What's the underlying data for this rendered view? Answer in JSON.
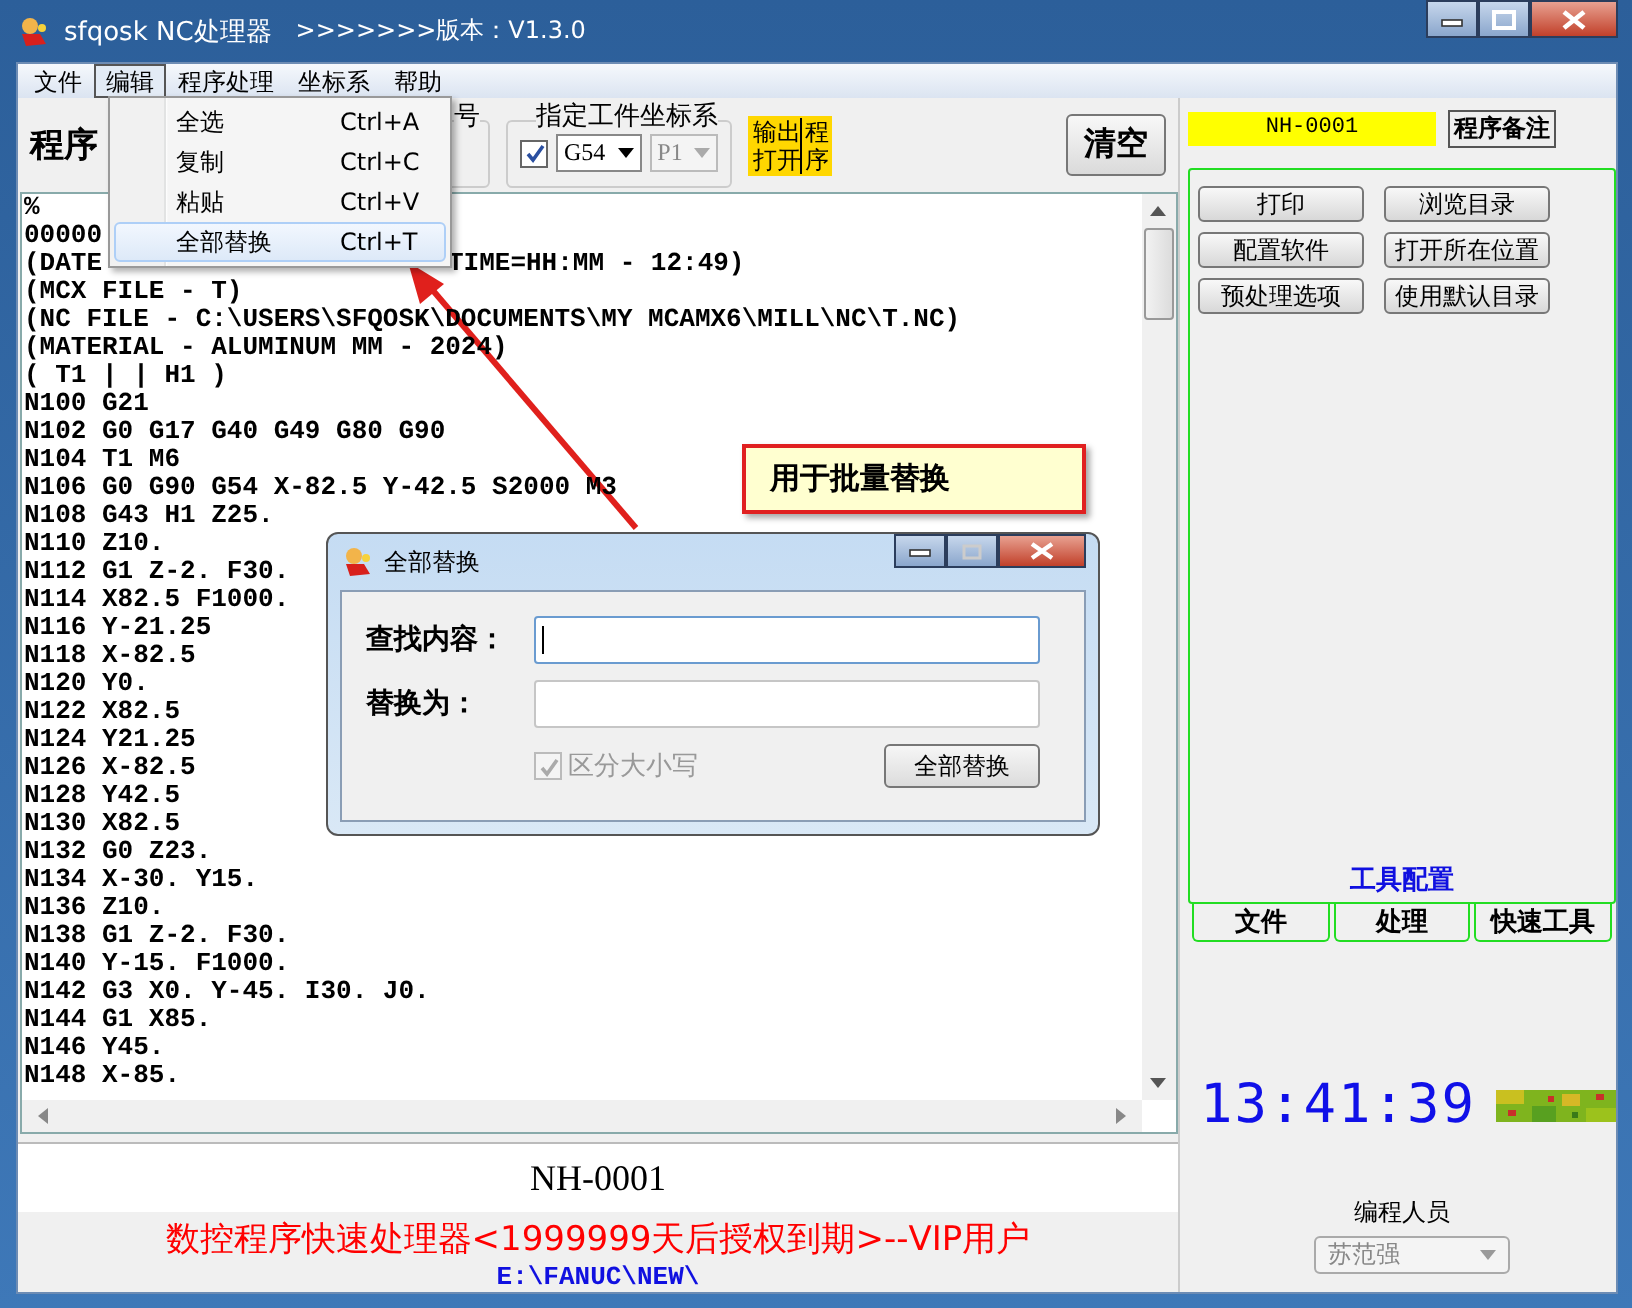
{
  "window": {
    "title": "sfqosk NC处理器",
    "version": ">>>>>>>版本：V1.3.0"
  },
  "menu": [
    {
      "label": "文件",
      "selected": false
    },
    {
      "label": "编辑",
      "selected": true
    },
    {
      "label": "程序处理",
      "selected": false
    },
    {
      "label": "坐标系",
      "selected": false
    },
    {
      "label": "帮助",
      "selected": false
    }
  ],
  "edit_menu": [
    {
      "label": "全选",
      "shortcut": "Ctrl+A",
      "selected": false
    },
    {
      "label": "复制",
      "shortcut": "Ctrl+C",
      "selected": false
    },
    {
      "label": "粘贴",
      "shortcut": "Ctrl+V",
      "selected": false
    },
    {
      "label": "全部替换",
      "shortcut": "Ctrl+T",
      "selected": true
    }
  ],
  "toolbar": {
    "program_label": "程序",
    "group_title": "号",
    "coord_group": {
      "title": "指定工件坐标系",
      "checked": true,
      "value": "G54",
      "value_2": "P1"
    },
    "output_button": {
      "left": [
        "输出",
        "打开"
      ],
      "right": [
        "程",
        "序"
      ]
    },
    "clear_button": "清空"
  },
  "editor": {
    "lines": [
      {
        "text": "%"
      },
      {
        "text": "00000"
      },
      {
        "text": "(DATE",
        "tail": "TIME=HH:MM - 12:49)"
      },
      {
        "text": "(MCX FILE - T)"
      },
      {
        "text": "(NC FILE - C:\\USERS\\SFQOSK\\DOCUMENTS\\MY MCAMX6\\MILL\\NC\\T.NC)"
      },
      {
        "text": "(MATERIAL - ALUMINUM MM - 2024)"
      },
      {
        "text": "( T1 | | H1 )"
      },
      {
        "text": "N100 G21"
      },
      {
        "text": "N102 G0 G17 G40 G49 G80 G90"
      },
      {
        "text": "N104 T1 M6"
      },
      {
        "text": "N106 G0 G90 G54 X-82.5 Y-42.5 S2000 M3"
      },
      {
        "text": "N108 G43 H1 Z25."
      },
      {
        "text": "N110 Z10."
      },
      {
        "text": "N112 G1 Z-2. F30."
      },
      {
        "text": "N114 X82.5 F1000."
      },
      {
        "text": "N116 Y-21.25"
      },
      {
        "text": "N118 X-82.5"
      },
      {
        "text": "N120 Y0."
      },
      {
        "text": "N122 X82.5"
      },
      {
        "text": "N124 Y21.25"
      },
      {
        "text": "N126 X-82.5"
      },
      {
        "text": "N128 Y42.5"
      },
      {
        "text": "N130 X82.5"
      },
      {
        "text": "N132 G0 Z23."
      },
      {
        "text": "N134 X-30. Y15."
      },
      {
        "text": "N136 Z10."
      },
      {
        "text": "N138 G1 Z-2. F30."
      },
      {
        "text": "N140 Y-15. F1000."
      },
      {
        "text": "N142 G3 X0. Y-45. I30. J0."
      },
      {
        "text": "N144 G1 X85."
      },
      {
        "text": "N146 Y45."
      },
      {
        "text": "N148 X-85."
      }
    ]
  },
  "program_name": "NH-0001",
  "license_text": "数控程序快速处理器<1999999天后授权到期>--VIP用户",
  "path": "E:\\FANUC\\NEW\\",
  "right_panel": {
    "program_no": "NH-0001",
    "note_button": "程序备注",
    "buttons": [
      "打印",
      "浏览目录",
      "配置软件",
      "打开所在位置",
      "预处理选项",
      "使用默认目录"
    ],
    "panel_title": "工具配置",
    "tabs": [
      {
        "label": "文件",
        "selected": false
      },
      {
        "label": "处理",
        "selected": false
      },
      {
        "label": "快速工具",
        "selected": false
      }
    ],
    "clock": "13:41:39",
    "programmer_label": "编程人员",
    "programmer": {
      "value": "苏范强",
      "disabled": true
    }
  },
  "callout": "用于批量替换",
  "dialog": {
    "title": "全部替换",
    "fields": [
      {
        "label": "查找内容：",
        "focused": true
      },
      {
        "label": "替换为：",
        "focused": false
      }
    ],
    "case_checkbox": {
      "label": "区分大小写",
      "checked": true,
      "disabled": true
    },
    "button": "全部替换"
  }
}
